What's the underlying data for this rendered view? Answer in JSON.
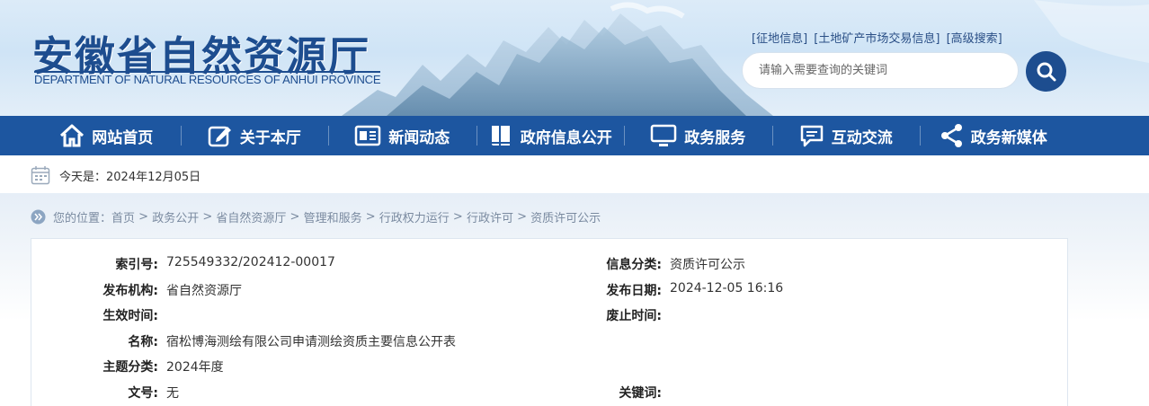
{
  "header": {
    "title": "安徽省自然资源厅",
    "subtitle": "DEPARTMENT OF NATURAL RESOURCES OF ANHUI PROVINCE",
    "top_links": [
      "[征地信息]",
      "[土地矿产市场交易信息]",
      "[高级搜索]"
    ],
    "search_placeholder": "请输入需要查询的关键词"
  },
  "nav": [
    {
      "label": "网站首页",
      "icon": "home-icon"
    },
    {
      "label": "关于本厅",
      "icon": "edit-icon"
    },
    {
      "label": "新闻动态",
      "icon": "newspaper-icon"
    },
    {
      "label": "政府信息公开",
      "icon": "book-icon"
    },
    {
      "label": "政务服务",
      "icon": "monitor-icon"
    },
    {
      "label": "互动交流",
      "icon": "chat-icon"
    },
    {
      "label": "政务新媒体",
      "icon": "share-icon"
    }
  ],
  "date_bar": {
    "text": "今天是：2024年12月05日"
  },
  "breadcrumb": {
    "prefix": "您的位置：",
    "items": [
      "首页",
      "政务公开",
      "省自然资源厅",
      "管理和服务",
      "行政权力运行",
      "行政许可",
      "资质许可公示"
    ],
    "separator": " > "
  },
  "info": {
    "index_label": "索引号:",
    "index_value": "725549332/202412-00017",
    "category_label": "信息分类:",
    "category_value": "资质许可公示",
    "publisher_label": "发布机构:",
    "publisher_value": "省自然资源厅",
    "pubdate_label": "发布日期:",
    "pubdate_value": "2024-12-05 16:16",
    "effective_label": "生效时间:",
    "effective_value": "",
    "expiry_label": "废止时间:",
    "expiry_value": "",
    "name_label": "名称:",
    "name_value": "宿松博海测绘有限公司申请测绘资质主要信息公开表",
    "topic_label": "主题分类:",
    "topic_value": "2024年度",
    "docno_label": "文号:",
    "docno_value": "无",
    "keywords_label": "关键词:",
    "keywords_value": ""
  },
  "colors": {
    "primary": "#1d56a0",
    "title": "#1d4d8f",
    "banner_bg": "#d6e8f7"
  }
}
